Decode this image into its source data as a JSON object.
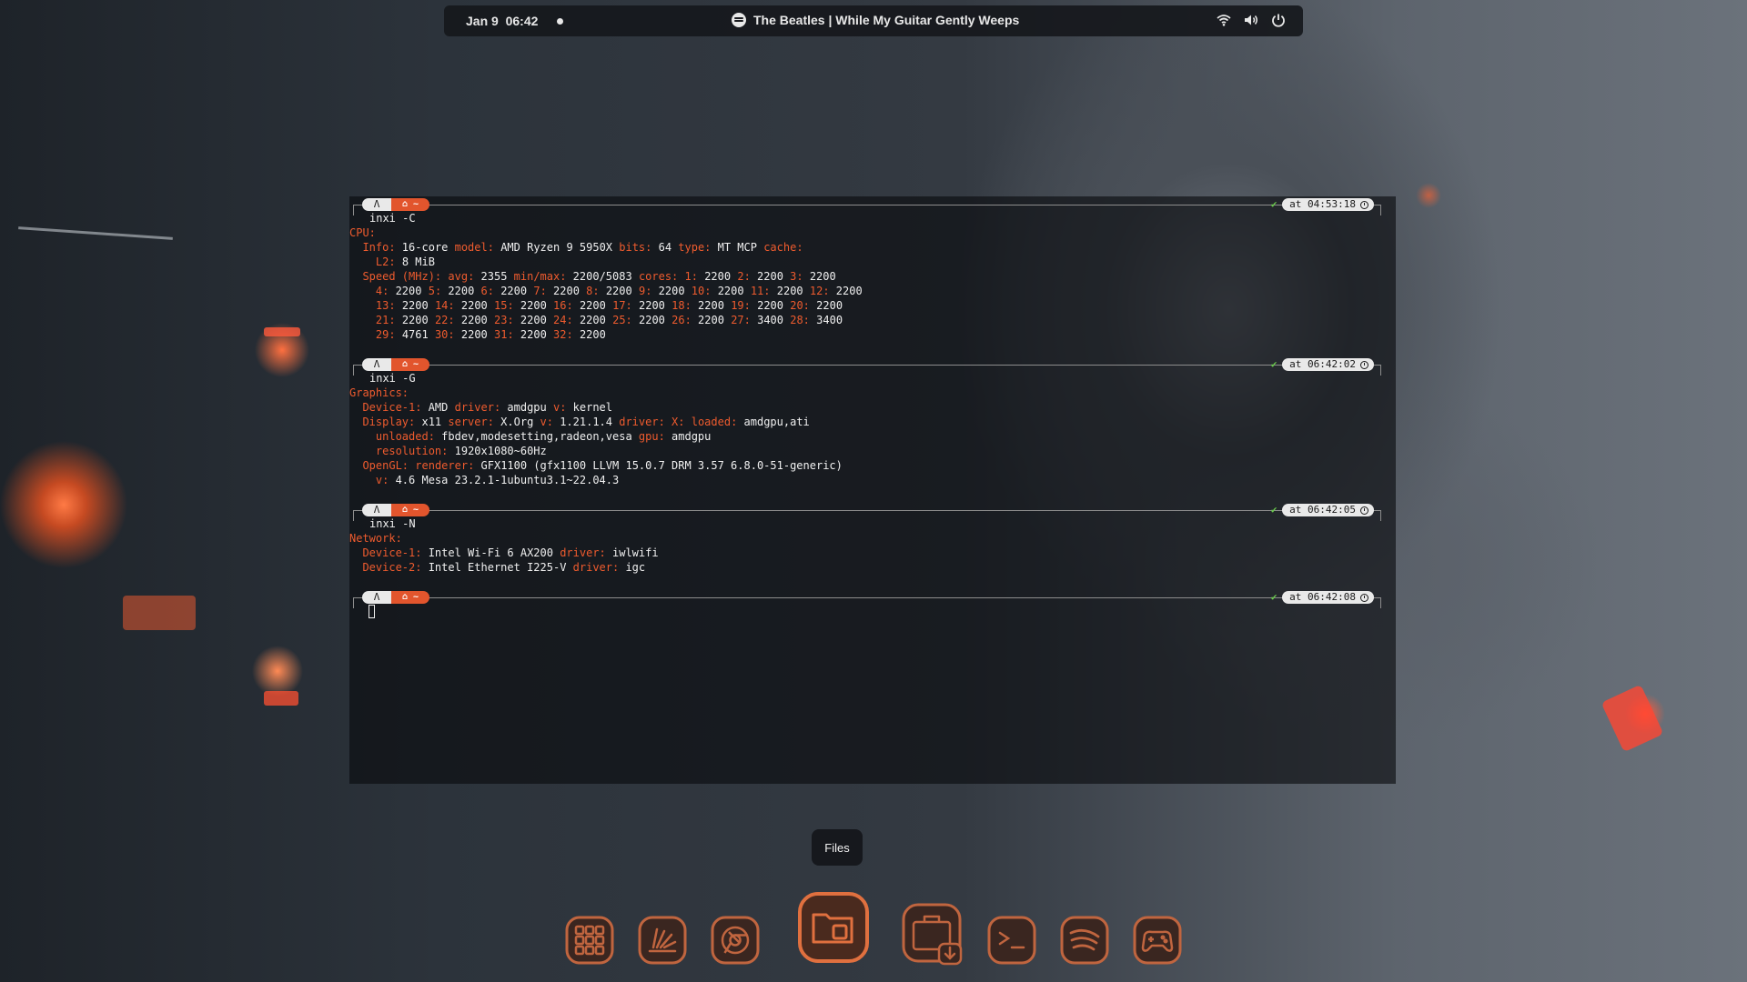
{
  "topbar": {
    "date": "Jan 9",
    "time": "06:42",
    "now_playing": "The Beatles | While My Guitar Gently Weeps",
    "icons": [
      "wifi-icon",
      "volume-icon",
      "power-icon"
    ]
  },
  "terminal": {
    "prompt": {
      "os_icon": "linux-icon",
      "dir_icon": "home-icon",
      "dir": "~"
    },
    "status_icon": "check-icon",
    "blocks": [
      {
        "time": "at 04:53:18",
        "command": "inxi -C",
        "lines": [
          [
            {
              "k": "CPU:"
            }
          ],
          [
            {
              "t": "  "
            },
            {
              "k": "Info:"
            },
            {
              "t": " 16-core "
            },
            {
              "k": "model:"
            },
            {
              "t": " AMD Ryzen 9 5950X "
            },
            {
              "k": "bits:"
            },
            {
              "t": " 64 "
            },
            {
              "k": "type:"
            },
            {
              "t": " MT MCP "
            },
            {
              "k": "cache:"
            }
          ],
          [
            {
              "t": "    "
            },
            {
              "k": "L2:"
            },
            {
              "t": " 8 MiB"
            }
          ],
          [
            {
              "t": "  "
            },
            {
              "k": "Speed (MHz):"
            },
            {
              "t": " "
            },
            {
              "k": "avg:"
            },
            {
              "t": " 2355 "
            },
            {
              "k": "min/max:"
            },
            {
              "t": " 2200/5083 "
            },
            {
              "k": "cores:"
            },
            {
              "t": " "
            },
            {
              "k": "1:"
            },
            {
              "t": " 2200 "
            },
            {
              "k": "2:"
            },
            {
              "t": " 2200 "
            },
            {
              "k": "3:"
            },
            {
              "t": " 2200"
            }
          ],
          [
            {
              "t": "    "
            },
            {
              "k": "4:"
            },
            {
              "t": " 2200 "
            },
            {
              "k": "5:"
            },
            {
              "t": " 2200 "
            },
            {
              "k": "6:"
            },
            {
              "t": " 2200 "
            },
            {
              "k": "7:"
            },
            {
              "t": " 2200 "
            },
            {
              "k": "8:"
            },
            {
              "t": " 2200 "
            },
            {
              "k": "9:"
            },
            {
              "t": " 2200 "
            },
            {
              "k": "10:"
            },
            {
              "t": " 2200 "
            },
            {
              "k": "11:"
            },
            {
              "t": " 2200 "
            },
            {
              "k": "12:"
            },
            {
              "t": " 2200"
            }
          ],
          [
            {
              "t": "    "
            },
            {
              "k": "13:"
            },
            {
              "t": " 2200 "
            },
            {
              "k": "14:"
            },
            {
              "t": " 2200 "
            },
            {
              "k": "15:"
            },
            {
              "t": " 2200 "
            },
            {
              "k": "16:"
            },
            {
              "t": " 2200 "
            },
            {
              "k": "17:"
            },
            {
              "t": " 2200 "
            },
            {
              "k": "18:"
            },
            {
              "t": " 2200 "
            },
            {
              "k": "19:"
            },
            {
              "t": " 2200 "
            },
            {
              "k": "20:"
            },
            {
              "t": " 2200"
            }
          ],
          [
            {
              "t": "    "
            },
            {
              "k": "21:"
            },
            {
              "t": " 2200 "
            },
            {
              "k": "22:"
            },
            {
              "t": " 2200 "
            },
            {
              "k": "23:"
            },
            {
              "t": " 2200 "
            },
            {
              "k": "24:"
            },
            {
              "t": " 2200 "
            },
            {
              "k": "25:"
            },
            {
              "t": " 2200 "
            },
            {
              "k": "26:"
            },
            {
              "t": " 2200 "
            },
            {
              "k": "27:"
            },
            {
              "t": " 3400 "
            },
            {
              "k": "28:"
            },
            {
              "t": " 3400"
            }
          ],
          [
            {
              "t": "    "
            },
            {
              "k": "29:"
            },
            {
              "t": " 4761 "
            },
            {
              "k": "30:"
            },
            {
              "t": " 2200 "
            },
            {
              "k": "31:"
            },
            {
              "t": " 2200 "
            },
            {
              "k": "32:"
            },
            {
              "t": " 2200"
            }
          ]
        ]
      },
      {
        "time": "at 06:42:02",
        "command": "inxi -G",
        "lines": [
          [
            {
              "k": "Graphics:"
            }
          ],
          [
            {
              "t": "  "
            },
            {
              "k": "Device-1:"
            },
            {
              "t": " AMD "
            },
            {
              "k": "driver:"
            },
            {
              "t": " amdgpu "
            },
            {
              "k": "v:"
            },
            {
              "t": " kernel"
            }
          ],
          [
            {
              "t": "  "
            },
            {
              "k": "Display:"
            },
            {
              "t": " x11 "
            },
            {
              "k": "server:"
            },
            {
              "t": " X.Org "
            },
            {
              "k": "v:"
            },
            {
              "t": " 1.21.1.4 "
            },
            {
              "k": "driver:"
            },
            {
              "t": " "
            },
            {
              "k": "X:"
            },
            {
              "t": " "
            },
            {
              "k": "loaded:"
            },
            {
              "t": " amdgpu,ati"
            }
          ],
          [
            {
              "t": "    "
            },
            {
              "k": "unloaded:"
            },
            {
              "t": " fbdev,modesetting,radeon,vesa "
            },
            {
              "k": "gpu:"
            },
            {
              "t": " amdgpu"
            }
          ],
          [
            {
              "t": "    "
            },
            {
              "k": "resolution:"
            },
            {
              "t": " 1920x1080~60Hz"
            }
          ],
          [
            {
              "t": "  "
            },
            {
              "k": "OpenGL:"
            },
            {
              "t": " "
            },
            {
              "k": "renderer:"
            },
            {
              "t": " GFX1100 (gfx1100 LLVM 15.0.7 DRM 3.57 6.8.0-51-generic)"
            }
          ],
          [
            {
              "t": "    "
            },
            {
              "k": "v:"
            },
            {
              "t": " 4.6 Mesa 23.2.1-1ubuntu3.1~22.04.3"
            }
          ]
        ]
      },
      {
        "time": "at 06:42:05",
        "command": "inxi -N",
        "lines": [
          [
            {
              "k": "Network:"
            }
          ],
          [
            {
              "t": "  "
            },
            {
              "k": "Device-1:"
            },
            {
              "t": " Intel Wi-Fi 6 AX200 "
            },
            {
              "k": "driver:"
            },
            {
              "t": " iwlwifi"
            }
          ],
          [
            {
              "t": "  "
            },
            {
              "k": "Device-2:"
            },
            {
              "t": " Intel Ethernet I225-V "
            },
            {
              "k": "driver:"
            },
            {
              "t": " igc"
            }
          ]
        ]
      },
      {
        "time": "at 06:42:08",
        "command": "",
        "lines": []
      }
    ]
  },
  "dock": {
    "tooltip": "Files",
    "items": [
      {
        "name": "app-grid",
        "icon": "grid-icon"
      },
      {
        "name": "system-tool",
        "icon": "app-icon"
      },
      {
        "name": "chrome",
        "icon": "chrome-icon"
      },
      {
        "name": "files",
        "icon": "folder-icon",
        "active": true
      },
      {
        "name": "software",
        "icon": "store-icon"
      },
      {
        "name": "terminal",
        "icon": "terminal-icon"
      },
      {
        "name": "spotify",
        "icon": "spotify-icon"
      },
      {
        "name": "games",
        "icon": "gamepad-icon"
      }
    ]
  },
  "colors": {
    "accent": "#ee5b2e",
    "ok": "#6ac84d",
    "dock_tile": "#b55e3a"
  }
}
